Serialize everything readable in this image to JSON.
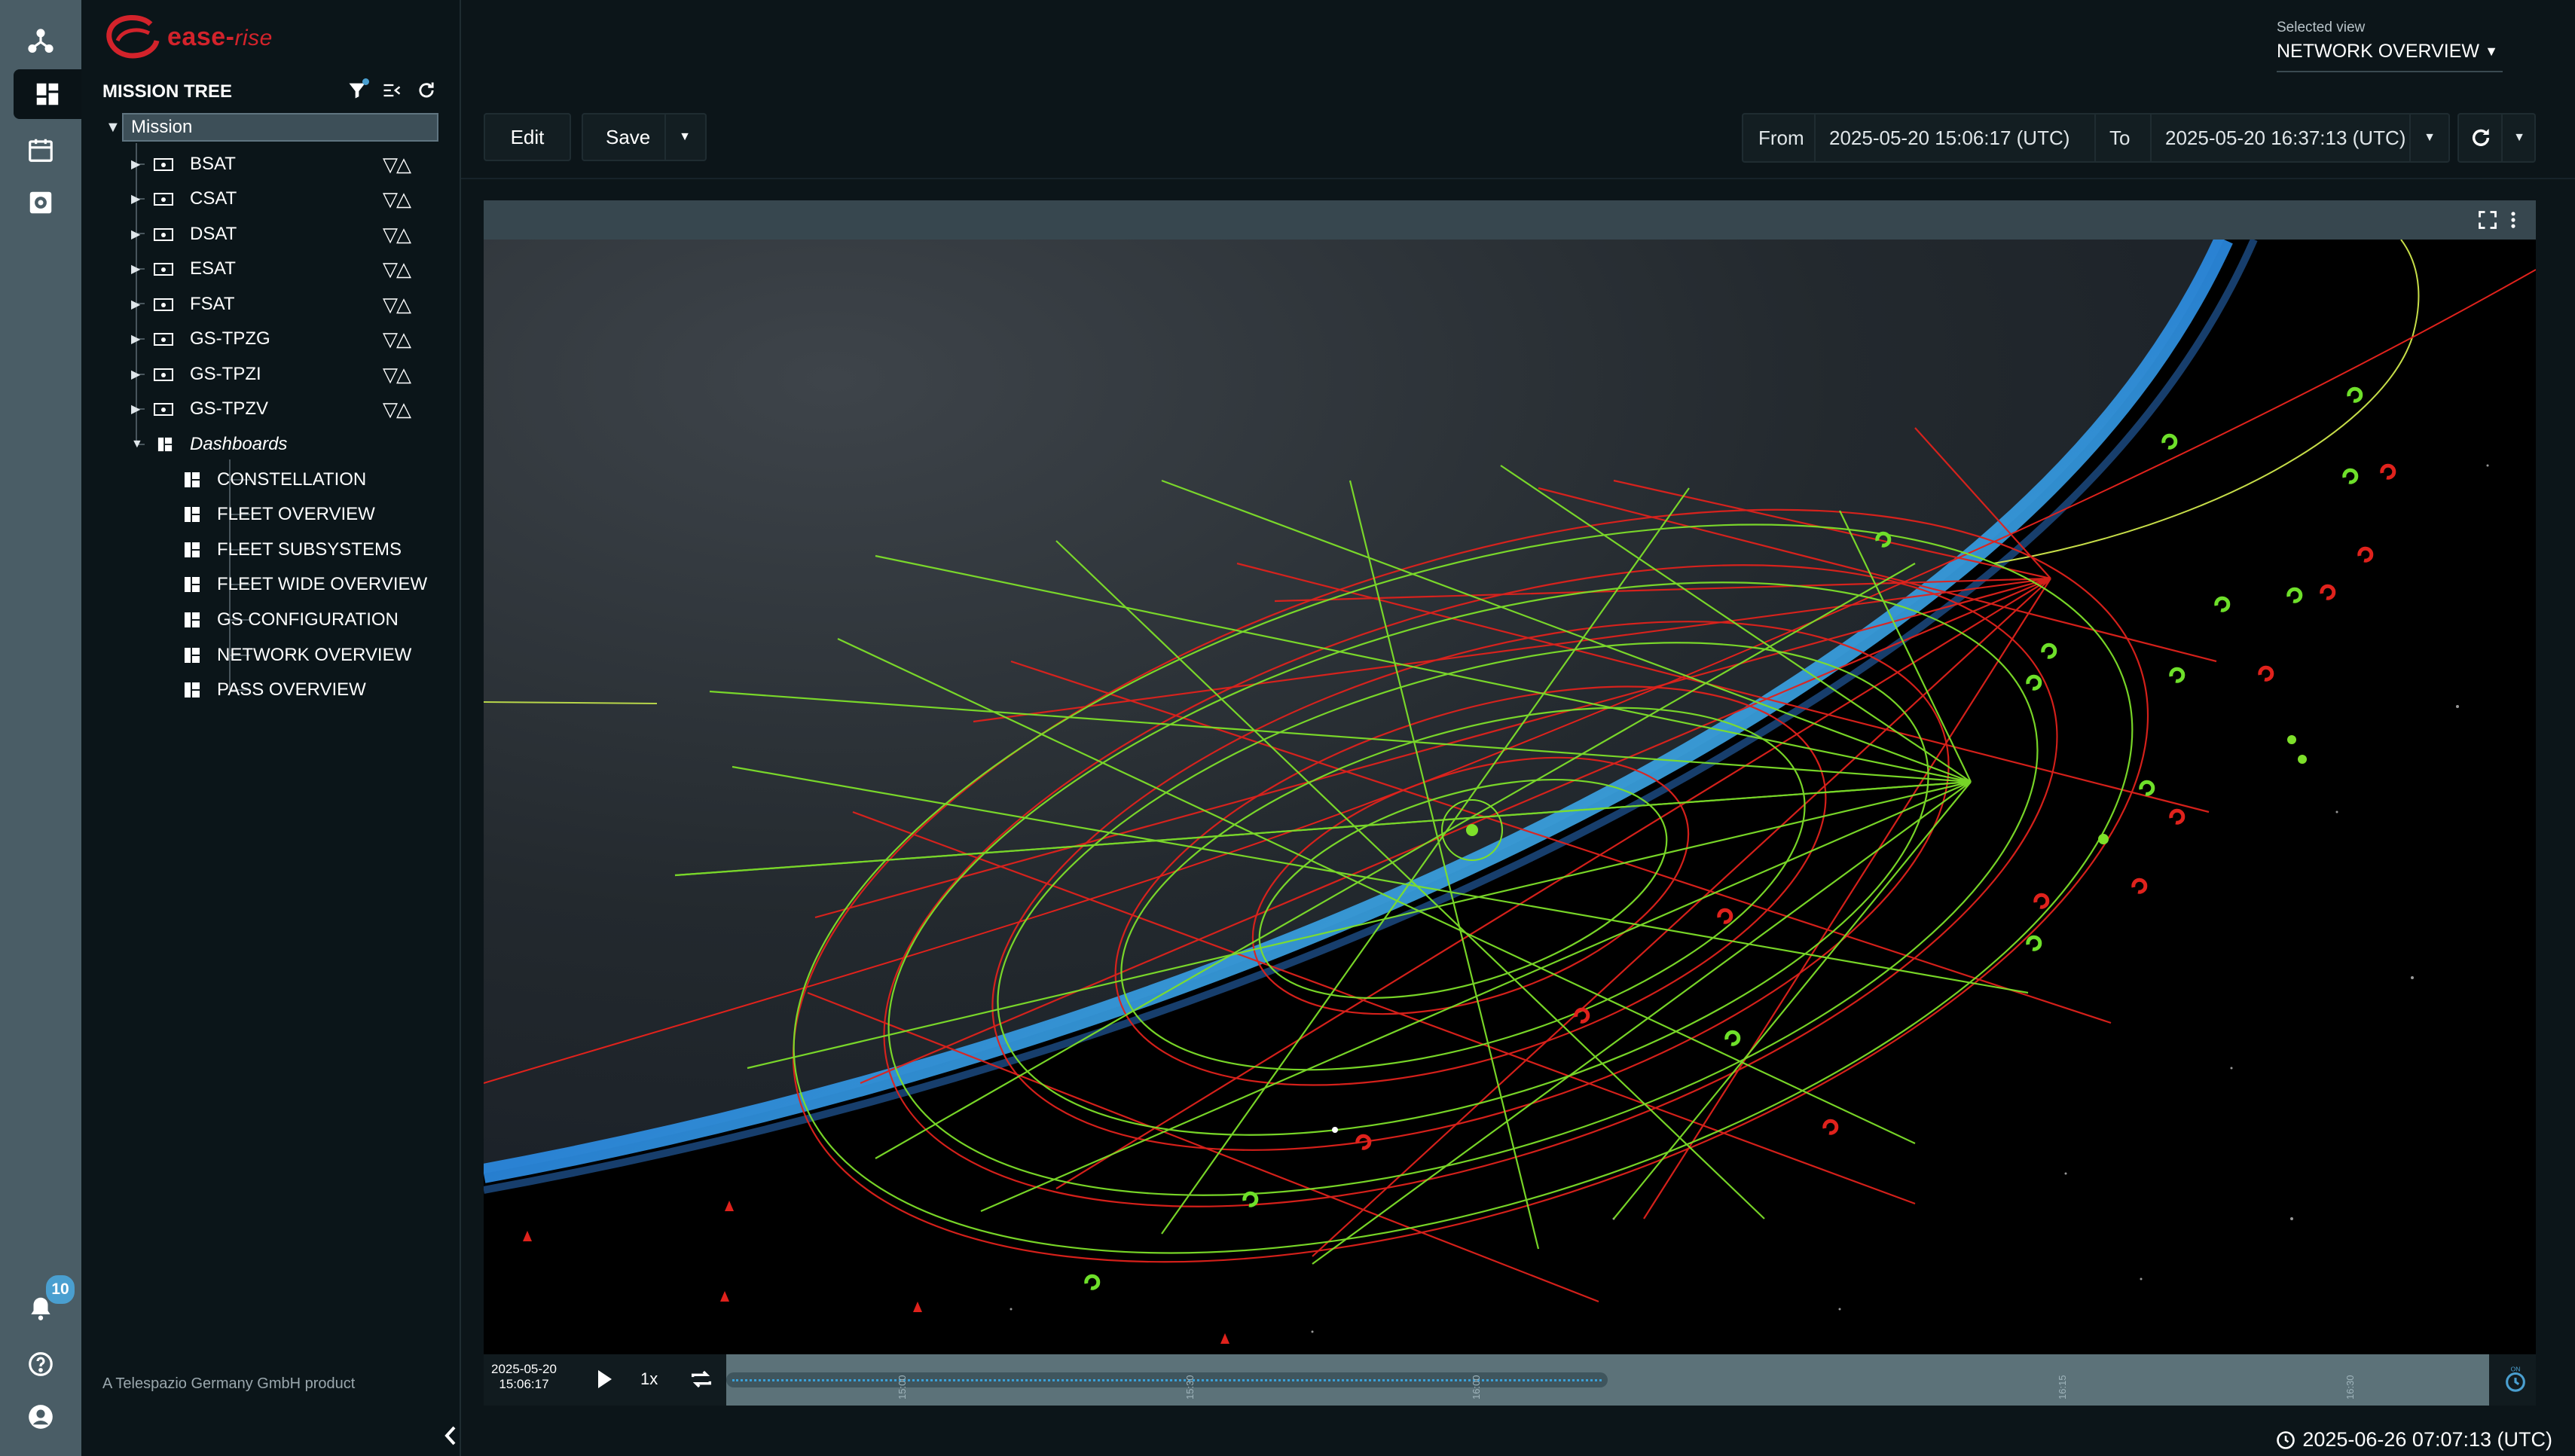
{
  "brand": {
    "name": "ease",
    "suffix": "rise",
    "color": "#d3232b"
  },
  "rail": {
    "items": [
      "network-icon",
      "dashboard-icon",
      "calendar-icon",
      "settings-icon"
    ],
    "bottom": [
      "bell-icon",
      "help-icon",
      "account-icon"
    ],
    "notification_count": "10"
  },
  "tree": {
    "title": "MISSION TREE",
    "root": "Mission",
    "items": [
      {
        "label": "BSAT"
      },
      {
        "label": "CSAT"
      },
      {
        "label": "DSAT"
      },
      {
        "label": "ESAT"
      },
      {
        "label": "FSAT"
      },
      {
        "label": "GS-TPZG"
      },
      {
        "label": "GS-TPZI"
      },
      {
        "label": "GS-TPZV"
      }
    ],
    "dashboards_label": "Dashboards",
    "dashboards": [
      {
        "label": "CONSTELLATION"
      },
      {
        "label": "FLEET OVERVIEW"
      },
      {
        "label": "FLEET SUBSYSTEMS"
      },
      {
        "label": "FLEET WIDE OVERVIEW"
      },
      {
        "label": "GS CONFIGURATION"
      },
      {
        "label": "NETWORK OVERVIEW"
      },
      {
        "label": "PASS OVERVIEW"
      }
    ],
    "footer": "A Telespazio Germany GmbH product"
  },
  "view": {
    "label": "Selected view",
    "value": "NETWORK OVERVIEW"
  },
  "toolbar": {
    "edit_label": "Edit",
    "save_label": "Save",
    "from_label": "From",
    "from_value": "2025-05-20 15:06:17 (UTC)",
    "to_label": "To",
    "to_value": "2025-05-20 16:37:13 (UTC)"
  },
  "timeline": {
    "date": "2025-05-20",
    "time": "15:06:17",
    "speed": "1x",
    "ticks": [
      "15:00",
      "15:30",
      "16:00",
      "16:15",
      "16:30"
    ],
    "progress": 0.5
  },
  "status": {
    "current_time": "2025-06-26 07:07:13 (UTC)"
  },
  "colors": {
    "accent": "#4a9fd0",
    "green_mesh": "#7ee02a",
    "red_mesh": "#e0221c"
  }
}
